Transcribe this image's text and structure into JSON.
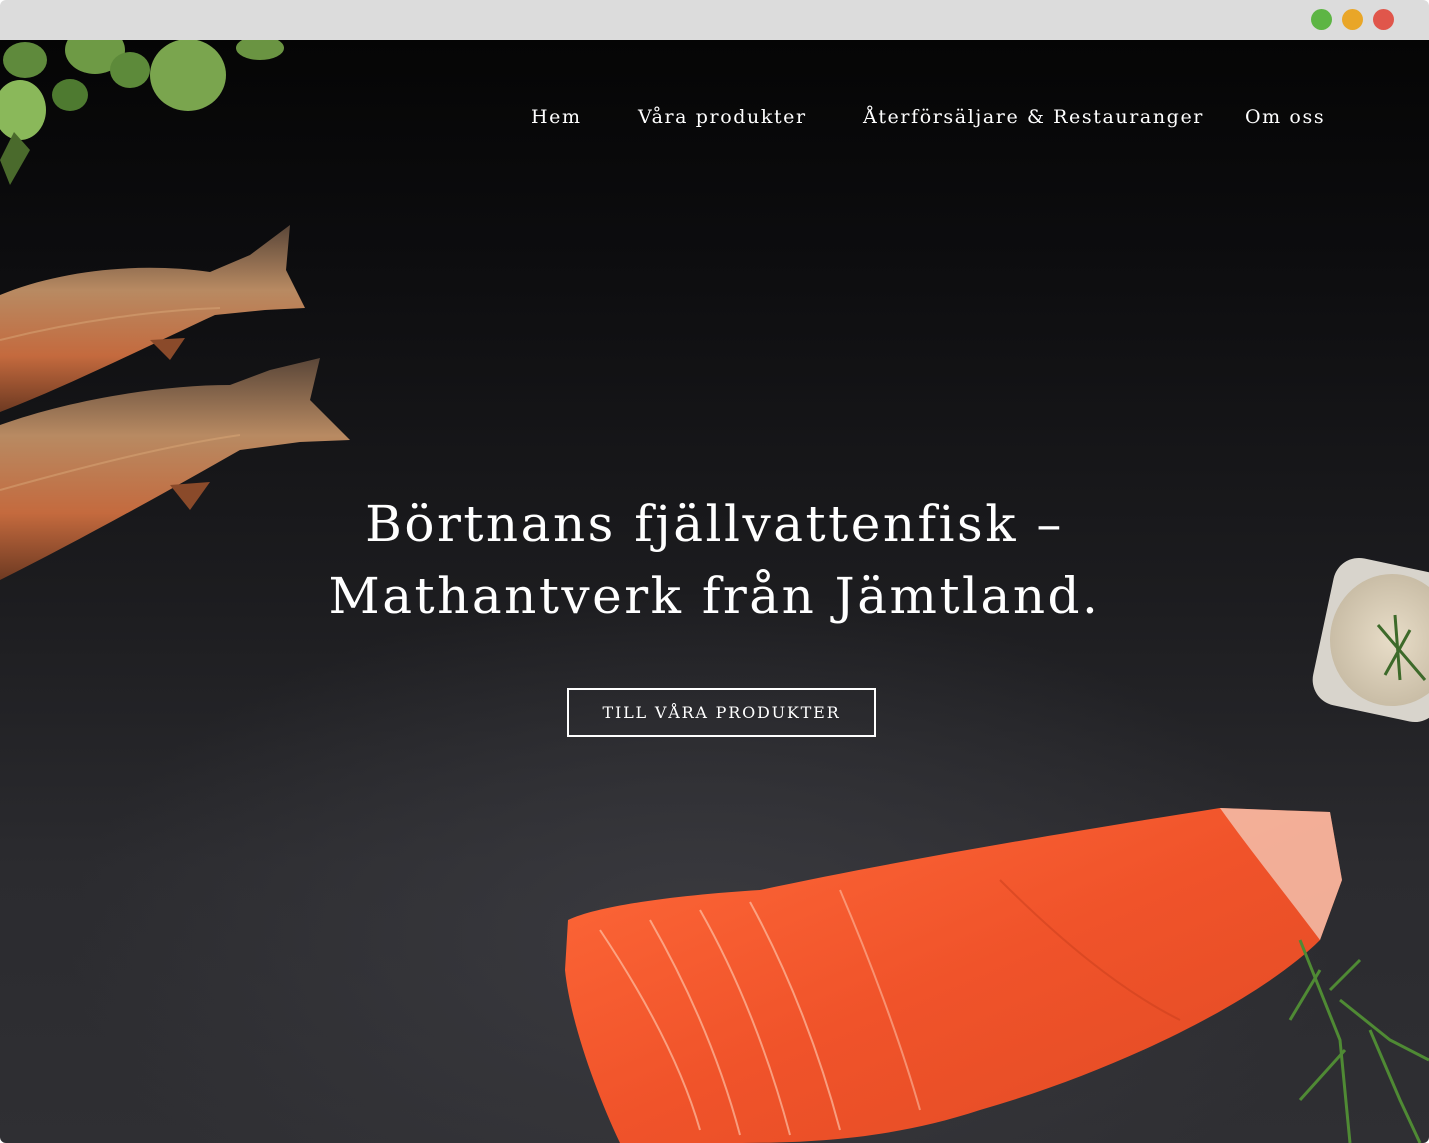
{
  "window": {
    "traffic_lights": [
      {
        "name": "minimize",
        "color": "#5db544"
      },
      {
        "name": "maximize",
        "color": "#e9a628"
      },
      {
        "name": "close",
        "color": "#e0564b"
      }
    ]
  },
  "nav": {
    "items": [
      {
        "label": "Hem"
      },
      {
        "label": "Våra produkter"
      },
      {
        "label": "Återförsäljare & Restauranger"
      },
      {
        "label": "Om oss"
      }
    ]
  },
  "hero": {
    "headline_line1": "Börtnans fjällvattenfisk –",
    "headline_line2": "Mathantverk från Jämtland.",
    "cta_label": "TILL VÅRA PRODUKTER",
    "images": [
      "leaves-image",
      "smoked-fish-image",
      "dip-bowl-image",
      "salmon-fillet-image",
      "dill-image"
    ]
  },
  "colors": {
    "background": "#1c1c1f",
    "text": "#ffffff",
    "salmon": "#f0532a"
  }
}
